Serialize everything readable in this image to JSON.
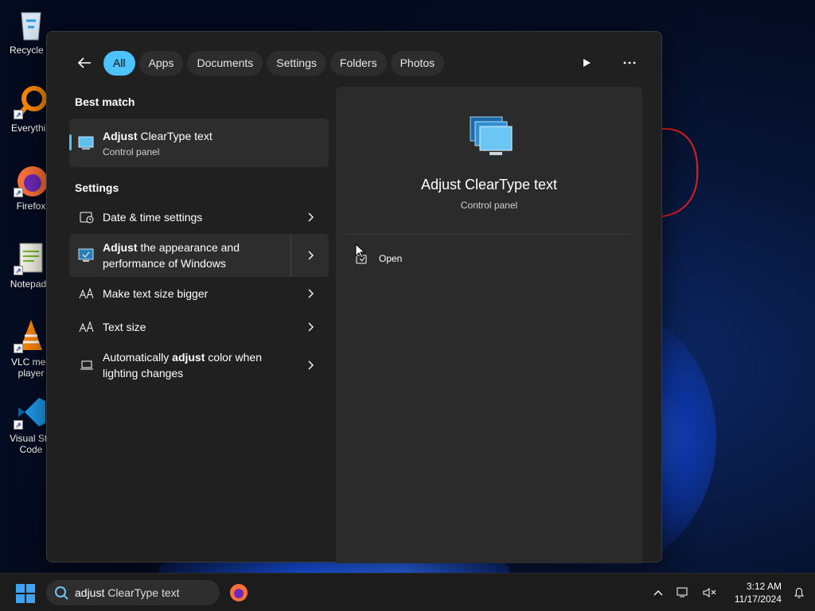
{
  "desktop": {
    "icons": [
      {
        "label": "Recycle B",
        "icon": "recycle-bin-icon"
      },
      {
        "label": "Everythin",
        "icon": "everything-search-icon"
      },
      {
        "label": "Firefox",
        "icon": "firefox-icon"
      },
      {
        "label": "Notepad+",
        "icon": "notepad-plus-plus-icon"
      },
      {
        "label": "VLC med player",
        "icon": "vlc-icon"
      },
      {
        "label": "Visual Stu Code",
        "icon": "vscode-icon"
      }
    ]
  },
  "search": {
    "filters": [
      "All",
      "Apps",
      "Documents",
      "Settings",
      "Folders",
      "Photos"
    ],
    "active_filter": "All",
    "best_match_heading": "Best match",
    "best_match": {
      "title_bold": "Adjust",
      "title_rest": " ClearType text",
      "subtitle": "Control panel"
    },
    "settings_heading": "Settings",
    "settings_items": [
      {
        "bold": "",
        "text": "Date & time settings"
      },
      {
        "bold": "Adjust",
        "text": " the appearance and performance of Windows"
      },
      {
        "bold": "",
        "text": "Make text size bigger"
      },
      {
        "bold": "",
        "text": "Text size"
      },
      {
        "pre": "Automatically ",
        "bold": "adjust",
        "text": " color when lighting changes"
      }
    ],
    "preview": {
      "title": "Adjust ClearType text",
      "subtitle": "Control panel",
      "action_open": "Open"
    }
  },
  "taskbar": {
    "search_query_prefix": "adjust",
    "search_query_rest": " ClearType text",
    "time": "3:12 AM",
    "date": "11/17/2024"
  },
  "colors": {
    "accent": "#4cc2ff",
    "panel": "#202020",
    "preview_bg": "#2b2b2b"
  }
}
